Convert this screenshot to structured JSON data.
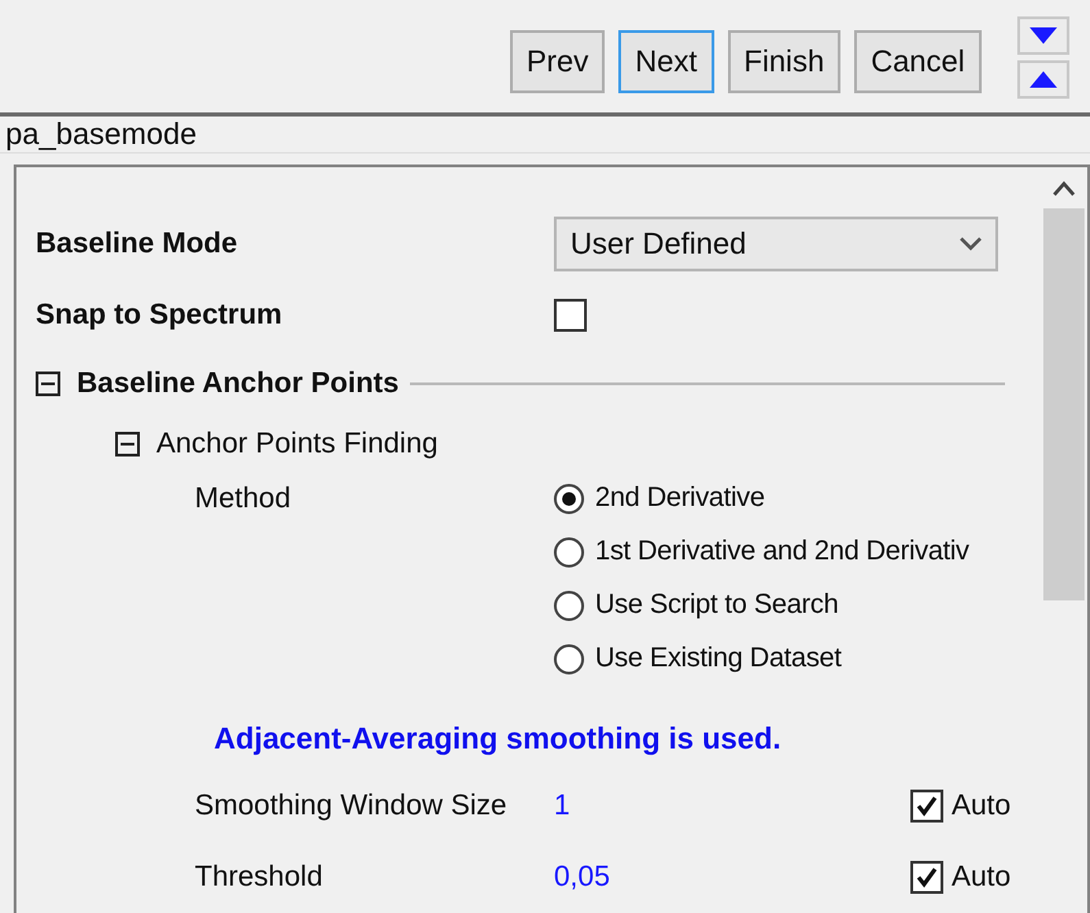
{
  "toolbar": {
    "buttons": [
      {
        "label": "Prev",
        "focused": false
      },
      {
        "label": "Next",
        "focused": true
      },
      {
        "label": "Finish",
        "focused": false
      },
      {
        "label": "Cancel",
        "focused": false
      }
    ]
  },
  "name_field": {
    "value": "pa_basemode"
  },
  "settings": {
    "baseline_mode": {
      "label": "Baseline Mode",
      "value": "User Defined"
    },
    "snap_to_spectrum": {
      "label": "Snap to Spectrum",
      "checked": false
    },
    "anchor_points": {
      "label": "Baseline Anchor Points",
      "expanded": true,
      "finding": {
        "label": "Anchor Points Finding",
        "expanded": true,
        "method": {
          "label": "Method",
          "options": [
            {
              "label": "2nd Derivative",
              "selected": true
            },
            {
              "label": "1st Derivative and 2nd Derivativ",
              "selected": false
            },
            {
              "label": "Use Script to Search",
              "selected": false
            },
            {
              "label": "Use Existing Dataset",
              "selected": false
            }
          ]
        },
        "note": "Adjacent-Averaging smoothing is used.",
        "params": [
          {
            "label": "Smoothing Window Size",
            "value": "1",
            "auto_label": "Auto",
            "auto": true
          },
          {
            "label": "Threshold",
            "value": "0,05",
            "auto_label": "Auto",
            "auto": true
          }
        ]
      }
    }
  }
}
